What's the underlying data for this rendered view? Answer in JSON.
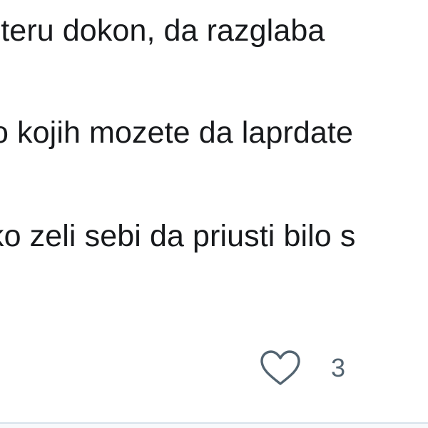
{
  "tweet": {
    "lines": [
      "viteru dokon, da razglaba ",
      "o kojih mozete da laprdate",
      "ko zeli sebi da priusti bilo s"
    ]
  },
  "actions": {
    "like_icon": "heart-outline-icon",
    "like_count": "3",
    "icon_color": "#536471"
  },
  "colors": {
    "background": "#ffffff",
    "text": "#17191c",
    "muted": "#536471",
    "divider": "#d8e2eb"
  }
}
